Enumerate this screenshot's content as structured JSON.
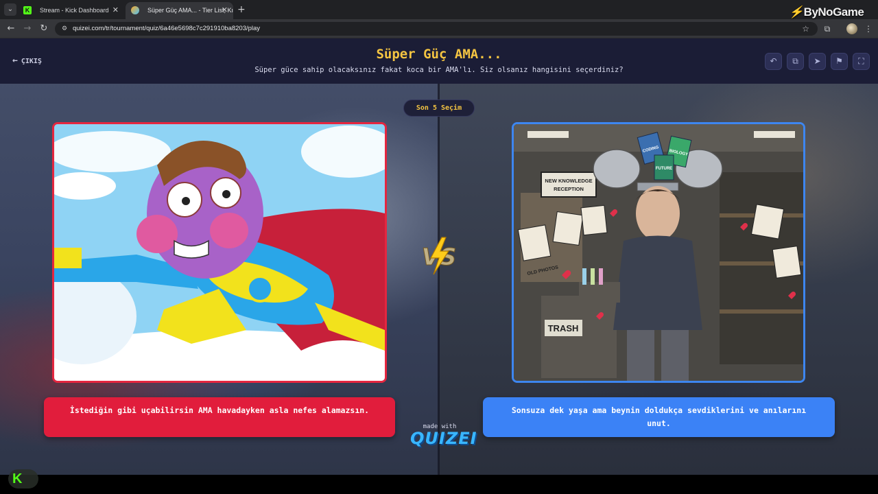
{
  "browser": {
    "tabs": [
      {
        "title": "Stream - Kick Dashboard",
        "favicon": "kick-icon",
        "active": false
      },
      {
        "title": "Süper Güç AMA... - Tier List, Kı",
        "favicon": "quizei-icon",
        "active": true
      }
    ],
    "url": "quizei.com/tr/tournament/quiz/6a46e5698c7c291910ba8203/play"
  },
  "watermark": {
    "text": "ByNoGame"
  },
  "header": {
    "exit_label": "ÇIKIŞ",
    "title": "Süper Güç AMA...",
    "subtitle": "Süper güce sahip olacaksınız fakat koca bir AMA'lı. Siz olsanız hangisini seçerdiniz?",
    "buttons": [
      "undo-icon",
      "share-icon",
      "send-icon",
      "flag-icon",
      "fullscreen-icon"
    ]
  },
  "last_choices_label": "Son 5 Seçim",
  "options": {
    "left": {
      "text": "İstediğin gibi uçabilirsin AMA havadayken asla nefes alamazsın.",
      "image_sign": "",
      "accent": "#e11d3c"
    },
    "right": {
      "text": "Sonsuza dek yaşa ama beynin doldukça sevdiklerini ve anılarını unut.",
      "image_sign": "NEW KNOWLEDGE RECEPTION",
      "image_trash": "TRASH",
      "book_labels": [
        "CODING",
        "FUTURE",
        "BIOLOGY"
      ],
      "photo_label": "OLD PHOTOS",
      "accent": "#3b82f6"
    }
  },
  "vs_label": "VS",
  "made_with": {
    "label": "made with",
    "logo": "QUIZEI"
  },
  "colors": {
    "header_bg": "#1b1d36",
    "title": "#f5c542",
    "left_accent": "#e11d3c",
    "right_accent": "#3b82f6"
  }
}
